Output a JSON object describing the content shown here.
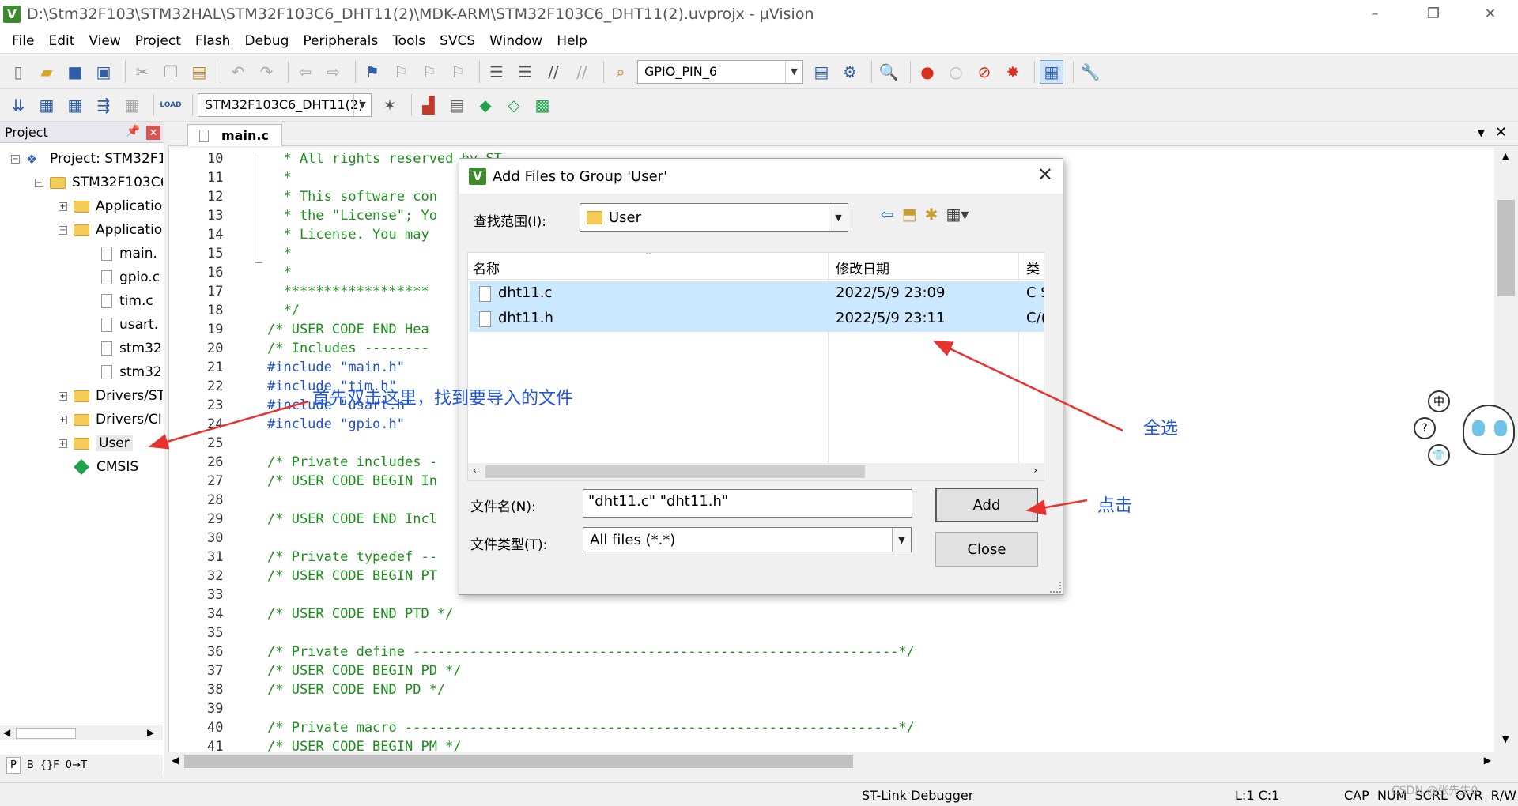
{
  "window": {
    "title": "D:\\Stm32F103\\STM32HAL\\STM32F103C6_DHT11(2)\\MDK-ARM\\STM32F103C6_DHT11(2).uvprojx - µVision",
    "app_icon": "V",
    "controls": [
      "–",
      "❐",
      "✕"
    ]
  },
  "menu": [
    "File",
    "Edit",
    "View",
    "Project",
    "Flash",
    "Debug",
    "Peripherals",
    "Tools",
    "SVCS",
    "Window",
    "Help"
  ],
  "toolbar1": {
    "find_combo_value": "GPIO_PIN_6"
  },
  "toolbar2": {
    "target_combo_value": "STM32F103C6_DHT11(2)",
    "load_label": "LOAD"
  },
  "project_pane": {
    "title": "Project",
    "pin": "📌",
    "close": "✕",
    "items": [
      {
        "label": "Project: STM32F1(",
        "kind": "project",
        "exp": "−"
      },
      {
        "label": "STM32F103C6",
        "kind": "target",
        "exp": "−"
      },
      {
        "label": "Applicatio",
        "kind": "folder",
        "exp": "+"
      },
      {
        "label": "Applicatio",
        "kind": "folder",
        "exp": "−"
      },
      {
        "label": "main.",
        "kind": "file"
      },
      {
        "label": "gpio.c",
        "kind": "file"
      },
      {
        "label": "tim.c",
        "kind": "file"
      },
      {
        "label": "usart.",
        "kind": "file"
      },
      {
        "label": "stm32",
        "kind": "file"
      },
      {
        "label": "stm32",
        "kind": "file"
      },
      {
        "label": "Drivers/ST",
        "kind": "folder",
        "exp": "+"
      },
      {
        "label": "Drivers/CI",
        "kind": "folder",
        "exp": "+"
      },
      {
        "label": "User",
        "kind": "folder",
        "exp": "+"
      },
      {
        "label": "CMSIS",
        "kind": "component"
      }
    ],
    "tabs": [
      "P",
      "B",
      "{}F",
      "0→T"
    ]
  },
  "editor": {
    "tab_label": "main.c",
    "lines": [
      {
        "n": "10",
        "text": "  * All rights reserved by ST.",
        "pp": false
      },
      {
        "n": "11",
        "text": "  *",
        "pp": false
      },
      {
        "n": "12",
        "text": "  * This software con",
        "pp": false
      },
      {
        "n": "13",
        "text": "  * the \"License\"; Yo",
        "pp": false
      },
      {
        "n": "14",
        "text": "  * License. You may",
        "pp": false
      },
      {
        "n": "15",
        "text": "  *",
        "pp": false
      },
      {
        "n": "16",
        "text": "  *",
        "pp": false
      },
      {
        "n": "17",
        "text": "  ******************",
        "pp": false
      },
      {
        "n": "18",
        "text": "  */",
        "pp": false
      },
      {
        "n": "19",
        "text": "/* USER CODE END Hea",
        "pp": false
      },
      {
        "n": "20",
        "text": "/* Includes --------",
        "pp": false
      },
      {
        "n": "21",
        "text": "#include \"main.h\"",
        "pp": true
      },
      {
        "n": "22",
        "text": "#include \"tim.h\"",
        "pp": true
      },
      {
        "n": "23",
        "text": "#include \"usart.h\"",
        "pp": true
      },
      {
        "n": "24",
        "text": "#include \"gpio.h\"",
        "pp": true
      },
      {
        "n": "25",
        "text": "",
        "pp": false
      },
      {
        "n": "26",
        "text": "/* Private includes -",
        "pp": false
      },
      {
        "n": "27",
        "text": "/* USER CODE BEGIN In",
        "pp": false
      },
      {
        "n": "28",
        "text": "",
        "pp": false
      },
      {
        "n": "29",
        "text": "/* USER CODE END Incl",
        "pp": false
      },
      {
        "n": "30",
        "text": "",
        "pp": false
      },
      {
        "n": "31",
        "text": "/* Private typedef --",
        "pp": false
      },
      {
        "n": "32",
        "text": "/* USER CODE BEGIN PT",
        "pp": false
      },
      {
        "n": "33",
        "text": "",
        "pp": false
      },
      {
        "n": "34",
        "text": "/* USER CODE END PTD */",
        "pp": false
      },
      {
        "n": "35",
        "text": "",
        "pp": false
      },
      {
        "n": "36",
        "text": "/* Private define ------------------------------------------------------------*/",
        "pp": false
      },
      {
        "n": "37",
        "text": "/* USER CODE BEGIN PD */",
        "pp": false
      },
      {
        "n": "38",
        "text": "/* USER CODE END PD */",
        "pp": false
      },
      {
        "n": "39",
        "text": "",
        "pp": false
      },
      {
        "n": "40",
        "text": "/* Private macro -------------------------------------------------------------*/",
        "pp": false
      },
      {
        "n": "41",
        "text": "/* USER CODE BEGIN PM */",
        "pp": false
      }
    ]
  },
  "dialog": {
    "title": "Add Files to Group 'User'",
    "close": "✕",
    "look_in_label": "查找范围(I):",
    "look_in_value": "User",
    "columns": {
      "name": "名称",
      "date": "修改日期",
      "type": "类"
    },
    "files": [
      {
        "name": "dht11.c",
        "date": "2022/5/9 23:09",
        "type": "C S"
      },
      {
        "name": "dht11.h",
        "date": "2022/5/9 23:11",
        "type": "C/("
      }
    ],
    "filename_label": "文件名(N):",
    "filename_value": "\"dht11.c\" \"dht11.h\"",
    "filetype_label": "文件类型(T):",
    "filetype_value": "All files (*.*)",
    "add_button": "Add",
    "close_button": "Close"
  },
  "annotations": {
    "step1": "首先双击这里，找到要导入的文件",
    "select_all": "全选",
    "click": "点击",
    "color": "#2157d8",
    "arrow_color": "#e8322d"
  },
  "status": {
    "debugger": "ST-Link Debugger",
    "position": "L:1 C:1",
    "flags": "CAP  NUM  SCRL  OVR  R/W"
  },
  "watermark": "CSDN @张先生0",
  "sticker_chars": [
    "中",
    "?",
    "👕"
  ]
}
